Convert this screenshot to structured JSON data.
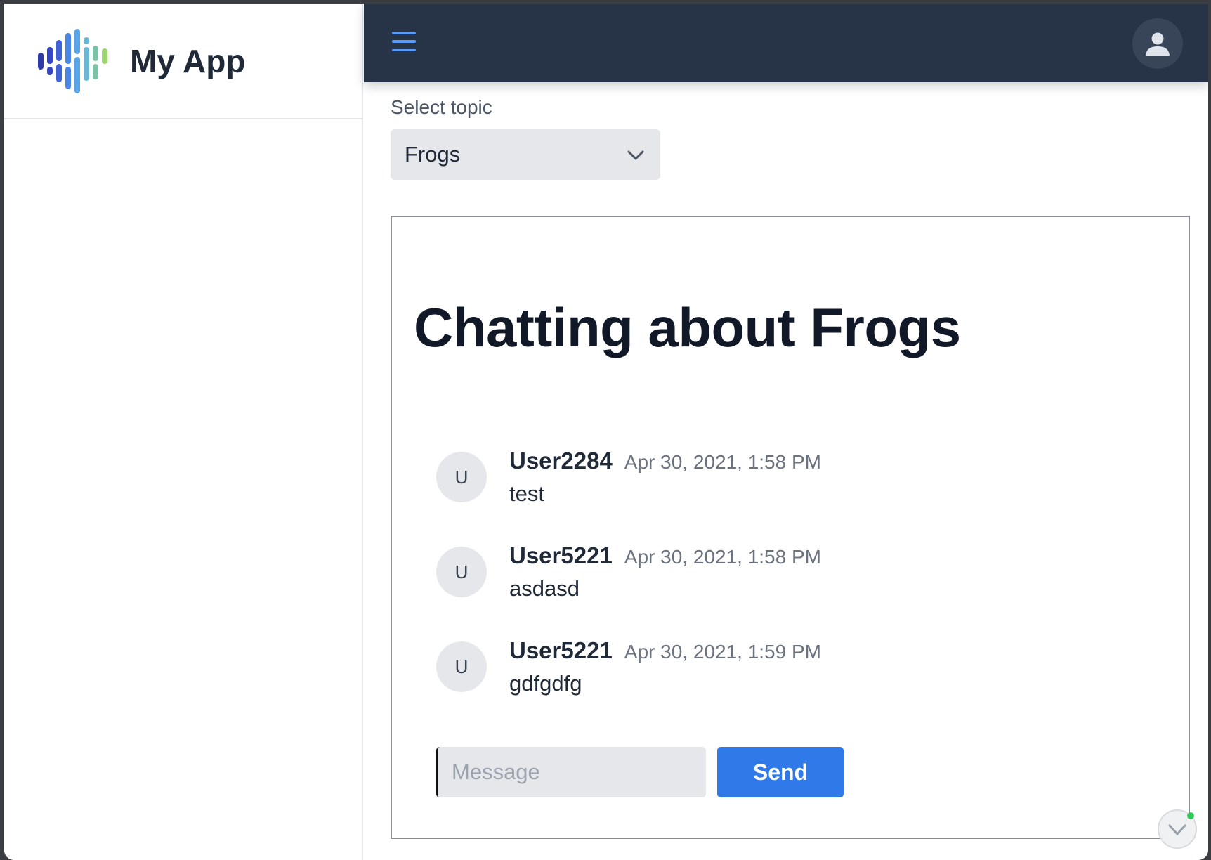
{
  "app": {
    "name": "My App"
  },
  "header": {
    "menu_icon": "hamburger-menu-icon",
    "user_icon": "user-avatar-icon"
  },
  "topic": {
    "label": "Select topic",
    "selected": "Frogs"
  },
  "chat": {
    "title": "Chatting about Frogs",
    "messages": [
      {
        "avatar": "U",
        "user": "User2284",
        "time": "Apr 30, 2021, 1:58 PM",
        "text": "test"
      },
      {
        "avatar": "U",
        "user": "User5221",
        "time": "Apr 30, 2021, 1:58 PM",
        "text": "asdasd"
      },
      {
        "avatar": "U",
        "user": "User5221",
        "time": "Apr 30, 2021, 1:59 PM",
        "text": "gdfgdfg"
      }
    ],
    "compose": {
      "placeholder": "Message",
      "value": "",
      "send_label": "Send"
    }
  },
  "colors": {
    "topbar": "#273447",
    "accent": "#3079e8",
    "menu_icon": "#5b9bf5"
  }
}
